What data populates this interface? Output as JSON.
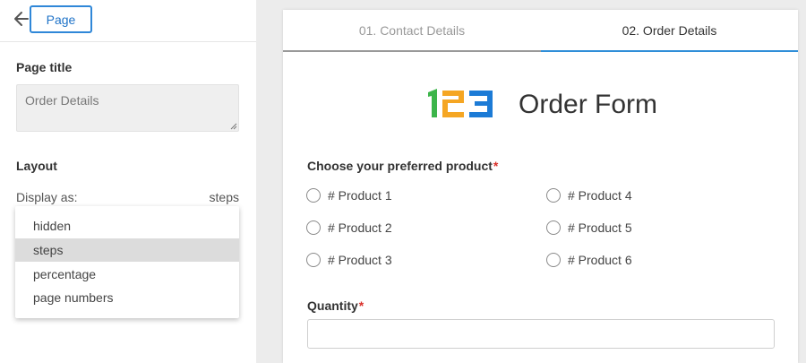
{
  "sidebar": {
    "page_button_label": "Page",
    "page_title_label": "Page title",
    "page_title_value": "Order Details",
    "layout_label": "Layout",
    "display_as_label": "Display as:",
    "display_as_value": "steps",
    "dropdown_options": [
      "hidden",
      "steps",
      "percentage",
      "page numbers"
    ],
    "selected_option": "steps",
    "icons": {
      "back": "arrow-left-icon",
      "resize": "resize-grip-icon"
    }
  },
  "form": {
    "tabs": [
      "01. Contact Details",
      "02. Order Details"
    ],
    "active_tab": "02. Order Details",
    "logo_text": "123",
    "title": "Order Form",
    "product_question": "Choose your preferred product",
    "products": [
      "# Product 1",
      "# Product 2",
      "# Product 3",
      "# Product 4",
      "# Product 5",
      "# Product 6"
    ],
    "quantity_label": "Quantity",
    "required_marker": "*"
  },
  "colors": {
    "accent_blue": "#2f87d8",
    "required_red": "#d9302a",
    "logo_green": "#3cb54a",
    "logo_orange": "#f5a623",
    "logo_blue": "#1c7bd6"
  }
}
